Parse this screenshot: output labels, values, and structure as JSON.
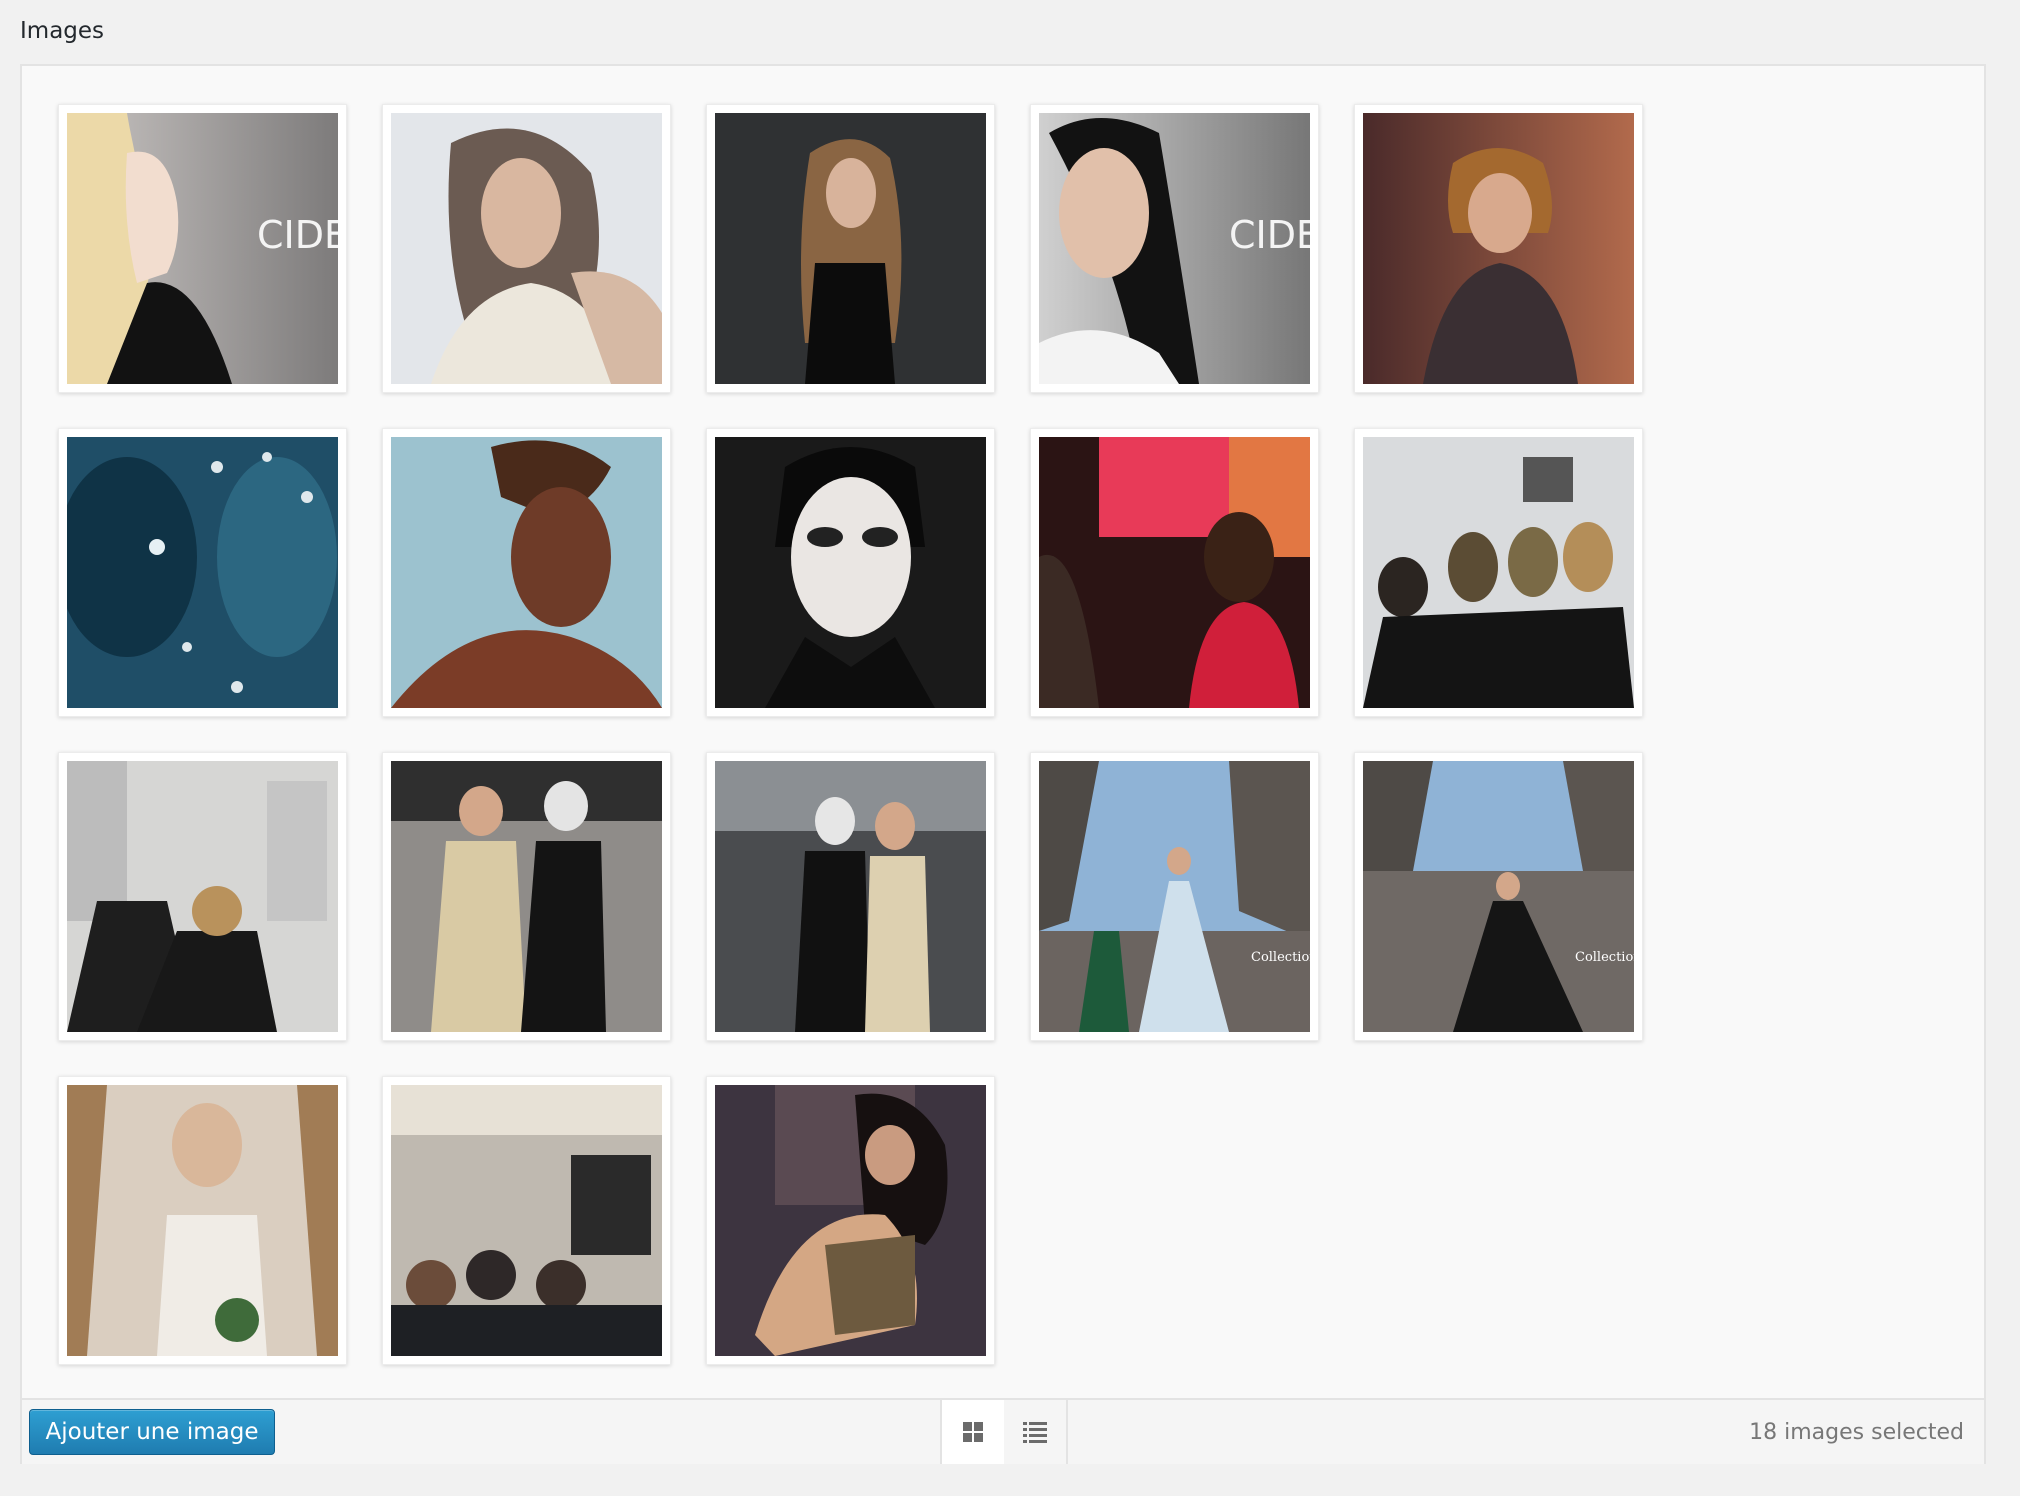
{
  "field": {
    "label": "Images"
  },
  "gallery": {
    "thumbnails": [
      {
        "name": "thumb-blonde-profile",
        "overlay_text": "CIDE"
      },
      {
        "name": "thumb-pale-portrait"
      },
      {
        "name": "thumb-long-hair-dark-bg"
      },
      {
        "name": "thumb-dark-hair-portrait",
        "overlay_text": "CIDE"
      },
      {
        "name": "thumb-bob-hair-woman"
      },
      {
        "name": "thumb-blue-face-art"
      },
      {
        "name": "thumb-bronze-body-paint"
      },
      {
        "name": "thumb-masquerade-makeup"
      },
      {
        "name": "thumb-makeup-demo-red"
      },
      {
        "name": "thumb-makeup-class-group"
      },
      {
        "name": "thumb-training-room"
      },
      {
        "name": "thumb-couple-street"
      },
      {
        "name": "thumb-couple-event"
      },
      {
        "name": "thumb-runway-white-gown",
        "overlay_text": "Collection WireImage"
      },
      {
        "name": "thumb-runway-black-gown",
        "overlay_text": "Collection WireImage"
      },
      {
        "name": "thumb-bride"
      },
      {
        "name": "thumb-backstage-crowd"
      },
      {
        "name": "thumb-leopard-dress"
      }
    ]
  },
  "toolbar": {
    "add_button": "Ajouter une image",
    "view_grid_icon": "grid-icon",
    "view_list_icon": "list-icon",
    "selected_count": "18 images selected"
  }
}
